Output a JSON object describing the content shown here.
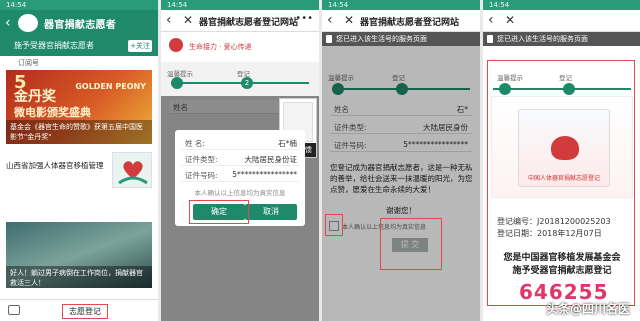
{
  "status_time": "14:54",
  "phone1": {
    "header_title": "器官捐献志愿者",
    "account_text": "施予受器官捐献志愿者",
    "follow_label": "+关注",
    "tag": "订阅号",
    "banner_big": "金丹奖",
    "banner_big2": "微电影颁奖盛典",
    "banner_en": "GOLDEN PEONY",
    "banner_num": "5",
    "banner_caption": "基金会《器官生命的赞歌》获第五届中国医影节\"金丹奖\"",
    "news1_title": "山西省加强人体器官移植管理",
    "news1_time": "",
    "photo2_caption": "好人！躺过男子病倒在工作岗位，捐献器官救活三人！",
    "menu_volunteer": "志愿登记"
  },
  "phone2": {
    "title": "器官捐献志愿者登记网站",
    "slogan": "生命接力 · 爱心传递",
    "step1": "温馨提示",
    "step2": "登记",
    "step2_num": "2",
    "name_label": "姓名",
    "dlg_name_label": "姓  名:",
    "dlg_name_value": "石*楠",
    "dlg_idtype_label": "证件类型:",
    "dlg_idtype_value": "大陆居民身份证",
    "dlg_idnum_label": "证件号码:",
    "dlg_idnum_value": "5****************",
    "dlg_note": "本人确认以上信息均为真实信息",
    "confirm_label": "确定",
    "cancel_label": "取消",
    "help_label": "求助反馈"
  },
  "phone3": {
    "title": "器官捐献志愿者登记网站",
    "notice": "您已进入该生活号的服务页面",
    "step1": "温馨提示",
    "step2": "登记",
    "name_label": "姓名",
    "name_value": "石*",
    "idtype_label": "证件类型:",
    "idtype_value": "大陆居民身份",
    "idnum_label": "证件号码:",
    "idnum_value": "5****************",
    "message": "您登记成为器官捐献志愿者，这是一种无私的善举，给社会送来一抹温暖的阳光，为您点赞，愿爱在生命永续的大爱！",
    "thanks": "谢谢您！",
    "consent": "本人确认以上信息均为真实信息",
    "submit_label": "提 交"
  },
  "phone4": {
    "notice": "您已进入该生活号的服务页面",
    "step1": "温馨提示",
    "step2": "登记",
    "cert_caption": "中国人体器官捐献志愿登记",
    "reg_num": "登记编号：J20181200025203",
    "reg_date": "登记日期：2018年12月07日",
    "reg_title1": "您是中国器官移植发展基金会",
    "reg_title2": "施予受器官捐献志愿登记",
    "reg_count": "646255"
  },
  "watermark": "头条@四川名医",
  "colors": {
    "brand_green": "#1e8a6a",
    "highlight_red": "#e24a4a",
    "count_pink": "#e2356a"
  }
}
